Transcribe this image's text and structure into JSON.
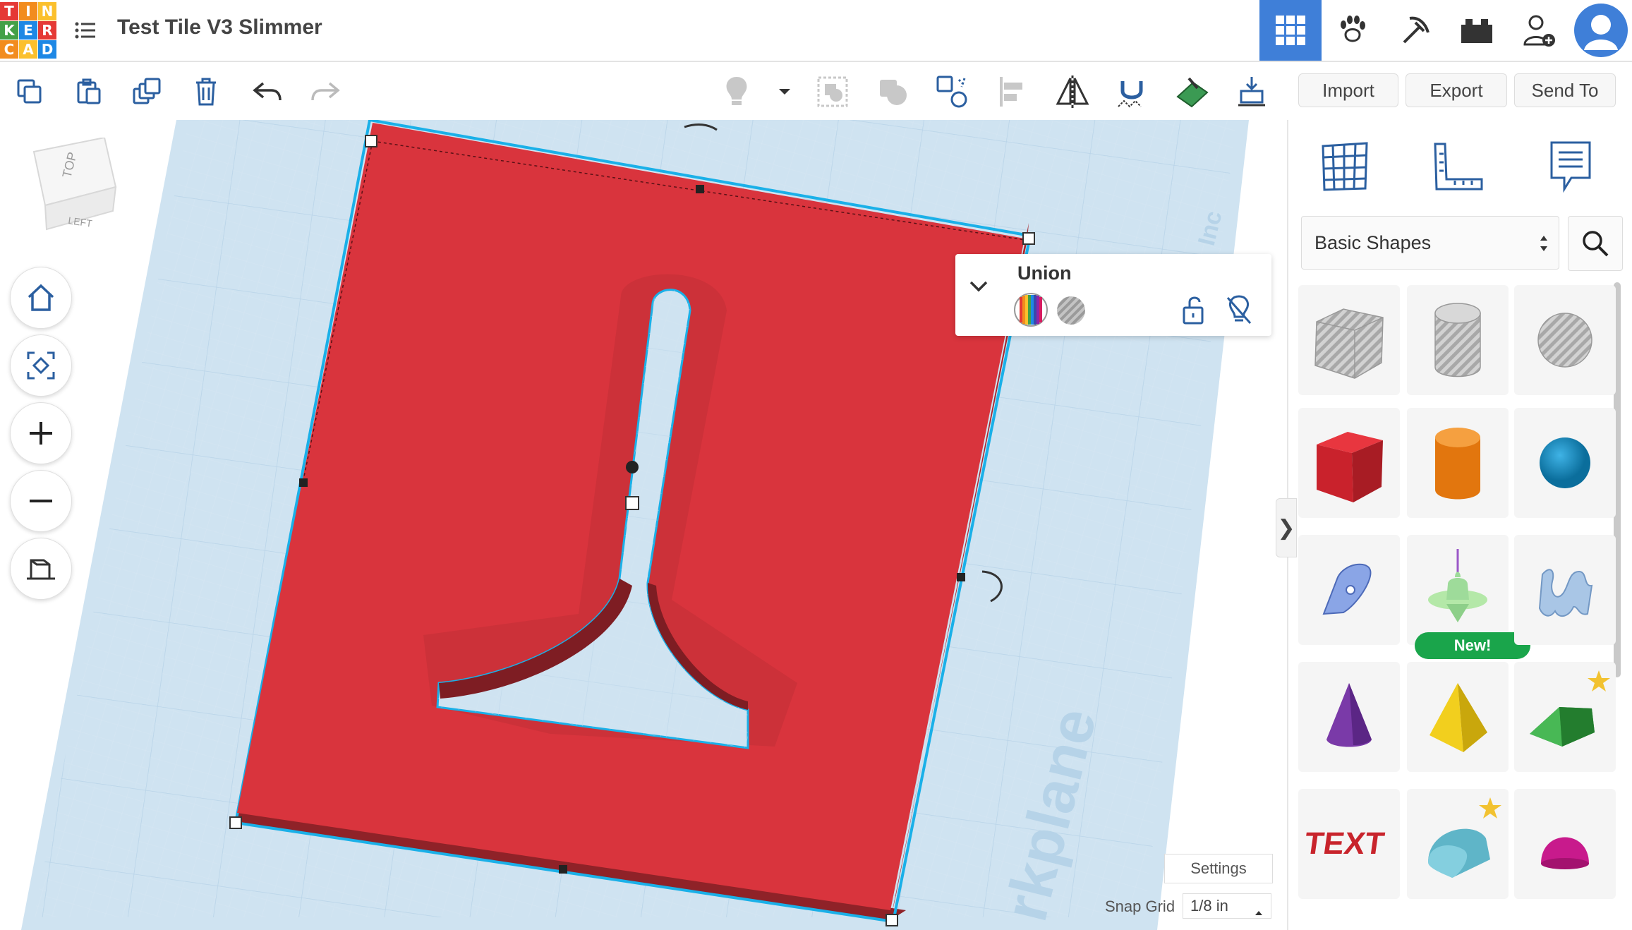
{
  "app": {
    "logo_letters": [
      "T",
      "I",
      "N",
      "K",
      "E",
      "R",
      "C",
      "A",
      "D"
    ],
    "logo_colors": [
      "#e53935",
      "#f28c1e",
      "#fbc02d",
      "#43a047",
      "#1e88e5",
      "#e53935",
      "#f28c1e",
      "#fbc02d",
      "#43a047"
    ],
    "title": "Test Tile V3 Slimmer"
  },
  "topbar": {
    "icons": [
      "grid-view-icon",
      "paw-icon",
      "pickaxe-icon",
      "bricks-icon",
      "add-user-icon",
      "user-avatar-icon"
    ],
    "active_color": "#3f7fd8"
  },
  "toolbar": {
    "icons": [
      "copy-icon",
      "paste-icon",
      "duplicate-icon",
      "delete-icon",
      "undo-icon",
      "redo-icon",
      "light-bulb-icon",
      "dropdown-icon",
      "group-icon",
      "union-icon",
      "cruise-icon",
      "align-icon",
      "mirror-icon",
      "magnet-icon",
      "workplane-icon",
      "drop-icon"
    ],
    "import_label": "Import",
    "export_label": "Export",
    "sendto_label": "Send To"
  },
  "viewcube": {
    "top": "TOP",
    "left": "LEFT"
  },
  "navigation": [
    "home-icon",
    "fit-view-icon",
    "zoom-in-icon",
    "zoom-out-icon",
    "perspective-icon"
  ],
  "inspector": {
    "name": "Union"
  },
  "canvas": {
    "workplane_text": "rkplane",
    "inches_text": "Inc",
    "shape_color": "#d9343d"
  },
  "sidebar": {
    "icons": [
      "grid-icon",
      "ruler-icon",
      "notes-icon"
    ],
    "category": "Basic Shapes",
    "shapes": [
      "Box (hole)",
      "Cylinder (hole)",
      "Sphere (hole)",
      "Box",
      "Cylinder",
      "Sphere",
      "Scribble",
      "Spinner",
      "Text 3D",
      "Cone",
      "Pyramid",
      "Roof",
      "Text",
      "Half Cylinder",
      "Half Sphere"
    ],
    "new_badge": "New!"
  },
  "footer": {
    "settings_label": "Settings",
    "snap_label": "Snap Grid",
    "snap_value": "1/8 in"
  }
}
